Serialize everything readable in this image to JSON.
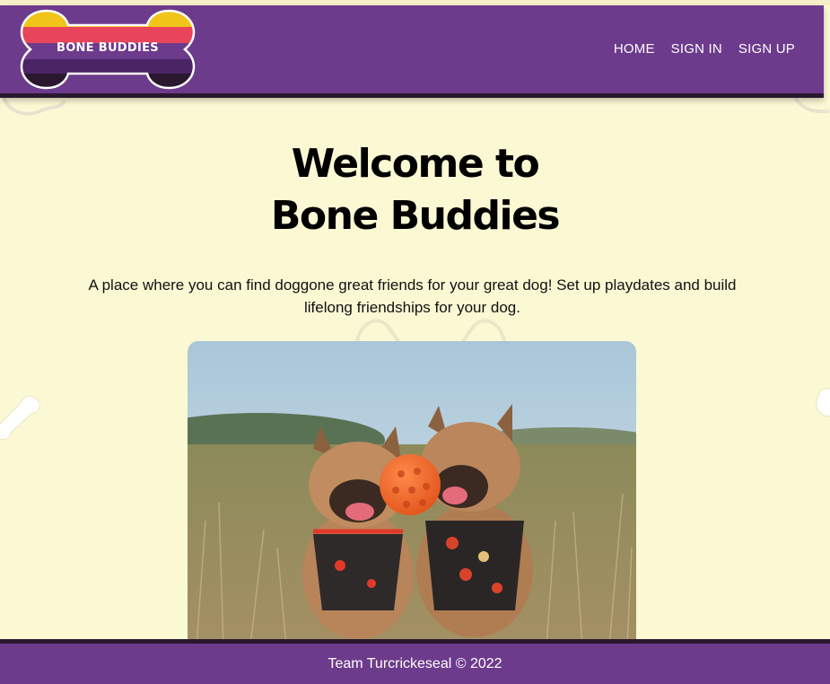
{
  "brand": {
    "logo_text": "BONE BUDDIES",
    "logo_colors": [
      "#f0c419",
      "#e9455a",
      "#6d3b8c",
      "#4a2463",
      "#2a1830"
    ]
  },
  "nav": {
    "items": [
      {
        "label": "HOME"
      },
      {
        "label": "SIGN IN"
      },
      {
        "label": "SIGN UP"
      }
    ]
  },
  "hero": {
    "title_line1": "Welcome to",
    "title_line2": "Bone Buddies",
    "tagline": "A place where you can find doggone great friends for your great dog! Set up playdates and build lifelong friendships for your dog.",
    "image_icon": "two-french-bulldogs-with-ball-photo"
  },
  "footer": {
    "text": "Team Turcrickeseal © 2022"
  },
  "colors": {
    "background": "#fbf8d4",
    "header": "#6d3b8c",
    "header_border": "#2a1830",
    "text": "#000000"
  }
}
